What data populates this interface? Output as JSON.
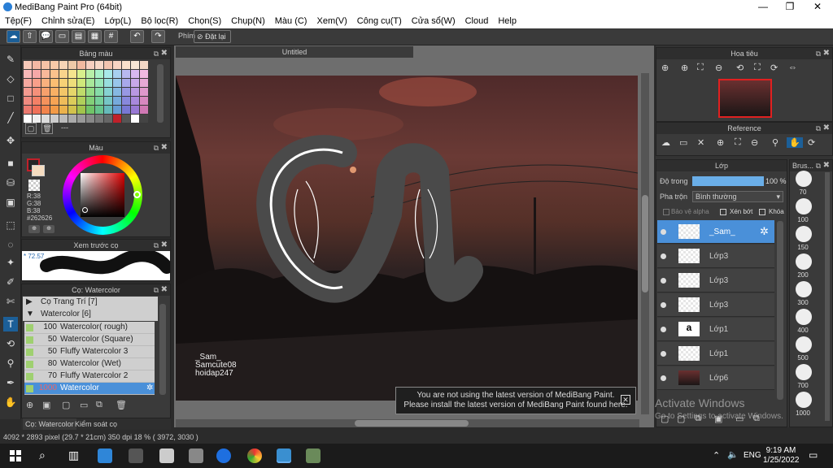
{
  "window": {
    "title": "MediBang Paint Pro (64bit)",
    "minimize": "—",
    "maximize": "❐",
    "close": "✕"
  },
  "menu": [
    "Tệp(F)",
    "Chỉnh sửa(E)",
    "Lớp(L)",
    "Bộ lọc(R)",
    "Chọn(S)",
    "Chụp(N)",
    "Màu (C)",
    "Xem(V)",
    "Công cụ(T)",
    "Cửa sổ(W)",
    "Cloud",
    "Help"
  ],
  "toolbar": {
    "phim_label": "Phím",
    "reset_label": "Đặt lại"
  },
  "palette": {
    "title": "Bảng màu",
    "footer_text": "---",
    "swatches": [
      "#f6c8b8",
      "#f4b8a4",
      "#f6c2a6",
      "#f9caa8",
      "#f7d4b6",
      "#eec9a8",
      "#f1b9a0",
      "#f6cfc0",
      "#f7d8c8",
      "#f2c4b0",
      "#f7d4c4",
      "#f9e0cc",
      "#f6e6d6",
      "#f3d7c5",
      "#f8b8b8",
      "#f6a8a8",
      "#f9b89a",
      "#fbc28c",
      "#f8d48c",
      "#f4e48e",
      "#d8f08c",
      "#b8f0a8",
      "#a8f0c8",
      "#a8e8e8",
      "#a8d0f0",
      "#b8b8f0",
      "#d8b8f0",
      "#f0b8e0",
      "#f6a8a0",
      "#f89f8a",
      "#f9b07e",
      "#fbbe72",
      "#f6d176",
      "#eede7a",
      "#cfe87a",
      "#a8e89a",
      "#98e6b8",
      "#98dede",
      "#98c6ea",
      "#a8a8ea",
      "#c8a8ea",
      "#e8a8d6",
      "#f49a90",
      "#f5907a",
      "#f7a06c",
      "#f8b064",
      "#f3c668",
      "#e6d66a",
      "#bfdc6a",
      "#94dc86",
      "#86dca8",
      "#86d2d2",
      "#86b8e2",
      "#9898e2",
      "#b898e2",
      "#e098cc",
      "#f08a80",
      "#f38066",
      "#f5925c",
      "#f6a454",
      "#efbc5a",
      "#dccc5a",
      "#b0d05a",
      "#82d078",
      "#76d09a",
      "#76c6c6",
      "#76aadc",
      "#8888dc",
      "#a888dc",
      "#d888c0",
      "#ec7a70",
      "#ef7058",
      "#f2844c",
      "#f29a46",
      "#ebb24c",
      "#d2c24c",
      "#a2c44c",
      "#70c468",
      "#66c48c",
      "#66baba",
      "#669cd4",
      "#7878d4",
      "#9878d4",
      "#d078b4",
      "#ffffff",
      "#eeeeee",
      "#dddddd",
      "#cccccc",
      "#bbbbbb",
      "#aaaaaa",
      "#999999",
      "#888888",
      "#777777",
      "#666666",
      "#c0202a",
      "#555555",
      "#ffffff",
      "#444444"
    ]
  },
  "color": {
    "title": "Màu",
    "primary": "#c0202a",
    "r": "R:38",
    "g": "G:38",
    "b": "B:38",
    "hex": "#262626"
  },
  "preview": {
    "title": "Xem trước cọ",
    "size": "* 72.57"
  },
  "brush_panel": {
    "title": "Cọ: Watercolor",
    "groups": [
      {
        "label": "Cọ Trang Trí [7]",
        "expanded": false
      },
      {
        "label": "Watercolor [6]",
        "expanded": true
      }
    ],
    "items": [
      {
        "size": "100",
        "name": "Watercolor( rough)"
      },
      {
        "size": "50",
        "name": "Watercolor (Square)"
      },
      {
        "size": "50",
        "name": "Fluffy Watercolor 3"
      },
      {
        "size": "80",
        "name": "Watercolor (Wet)"
      },
      {
        "size": "70",
        "name": "Fluffy Watercolor 2"
      },
      {
        "size": "1000",
        "name": "Watercolor"
      }
    ],
    "tabs": [
      "Cọ: Watercolor",
      "Kiểm soát cọ"
    ]
  },
  "document": {
    "tab": "Untitled"
  },
  "canvas_text": {
    "line1": "_Sam_",
    "line2": "Samcute08",
    "line3": "hoidap247"
  },
  "notice": {
    "line1": "You are not using the latest version of MediBang Paint.",
    "line2": "Please install the latest version of MediBang Paint found here."
  },
  "navigator": {
    "title": "Hoa tiêu"
  },
  "reference": {
    "title": "Reference"
  },
  "layer": {
    "title": "Lớp",
    "opacity_label": "Độ trong",
    "opacity_value": "100 %",
    "opacity_fraction": 1.0,
    "blend_label": "Pha trộn",
    "blend_value": "Bình thường",
    "protect_alpha": "Bảo vệ alpha",
    "clipping": "Xén bớt",
    "lock": "Khóa",
    "layers": [
      {
        "name": "_Sam_",
        "selected": true
      },
      {
        "name": "Lớp3",
        "selected": false
      },
      {
        "name": "Lớp3",
        "selected": false
      },
      {
        "name": "Lớp3",
        "selected": false
      },
      {
        "name": "Lớp1",
        "selected": false
      },
      {
        "name": "Lớp1",
        "selected": false
      },
      {
        "name": "Lớp6",
        "selected": false
      }
    ]
  },
  "brush_size": {
    "title": "Brus...",
    "sizes": [
      "70",
      "100",
      "150",
      "200",
      "300",
      "400",
      "500",
      "700",
      "1000"
    ]
  },
  "watermark": {
    "line1": "Activate Windows",
    "line2": "Go to Settings to activate Windows."
  },
  "status": {
    "dimensions": "4092 * 2893 pixel",
    "size_cm": "(29.7 * 21cm)",
    "dpi": "350 dpi",
    "zoom": "18 %",
    "coords": "( 3972, 3030 )"
  },
  "taskbar": {
    "lang": "ENG",
    "time": "9:19 AM",
    "date": "1/25/2022"
  }
}
